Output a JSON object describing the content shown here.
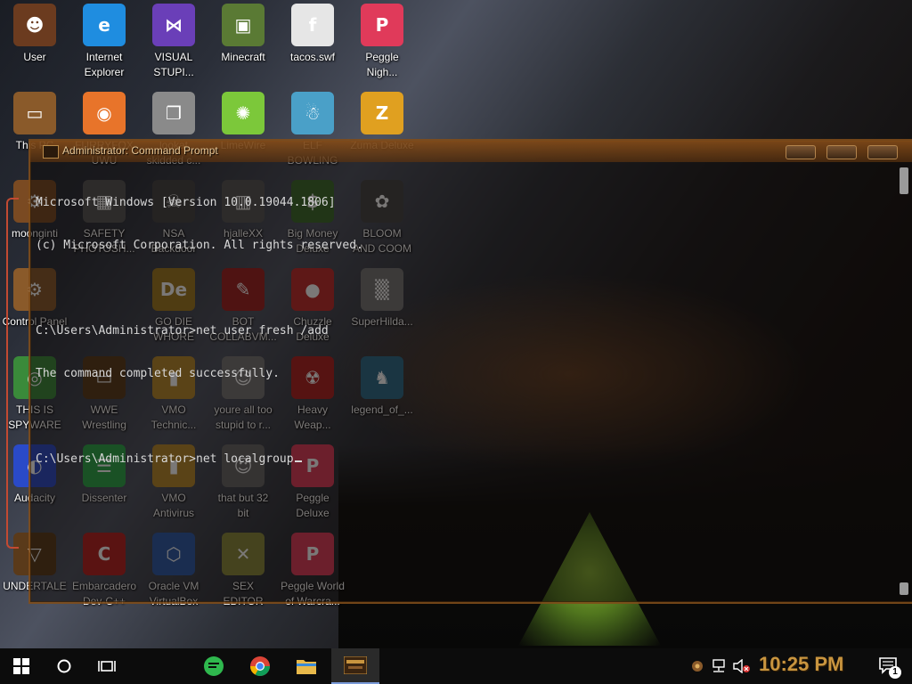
{
  "desktop": {
    "icons": [
      {
        "label": "User",
        "color": "#6b3b1f",
        "glyph": "☻"
      },
      {
        "label": "Internet\nExplorer",
        "color": "#1f8de0",
        "glyph": "e"
      },
      {
        "label": "VISUAL\nSTUPI...",
        "color": "#6a3fb8",
        "glyph": "⋈"
      },
      {
        "label": "Minecraft",
        "color": "#5a7a34",
        "glyph": "▣"
      },
      {
        "label": "tacos.swf",
        "color": "#e6e6e6",
        "glyph": "f"
      },
      {
        "label": "Peggle\nNigh...",
        "color": "#e03a5a",
        "glyph": "P"
      },
      {
        "label": "This PC",
        "color": "#8a5a2a",
        "glyph": "▭"
      },
      {
        "label": "FURRYFOX\nUWU",
        "color": "#e8742a",
        "glyph": "◉"
      },
      {
        "label": "lookat\nskidded c...",
        "color": "#8a8a8a",
        "glyph": "❐"
      },
      {
        "label": "LimeWire",
        "color": "#7cc83a",
        "glyph": "✺"
      },
      {
        "label": "ELF\nBOWLING",
        "color": "#4aa0c8",
        "glyph": "☃"
      },
      {
        "label": "Zuma Deluxe",
        "color": "#e0a020",
        "glyph": "Z"
      },
      {
        "label": "moonginti",
        "color": "#7a4a22",
        "glyph": "⚙"
      },
      {
        "label": "SAFETY\nPHOTOSH...",
        "color": "#555555",
        "glyph": "▦"
      },
      {
        "label": "NSA\nBackdoor",
        "color": "#444444",
        "glyph": "☠"
      },
      {
        "label": "hjalleXX",
        "color": "#555555",
        "glyph": "▥"
      },
      {
        "label": "Big Money\nDeluxe",
        "color": "#3a6a2a",
        "glyph": "$"
      },
      {
        "label": "BLOOM\nAND COOM",
        "color": "#444444",
        "glyph": "✿"
      },
      {
        "label": "Control Panel",
        "color": "#8a5a2a",
        "glyph": "⚙"
      },
      {
        "label": "GO DIE\nWHORE",
        "color": "#a07a20",
        "glyph": "De"
      },
      {
        "label": "BOT\nCOLLABVM...",
        "color": "#a02020",
        "glyph": "✎"
      },
      {
        "label": "Chuzzle\nDeluxe",
        "color": "#c02a2a",
        "glyph": "●"
      },
      {
        "label": "SuperHilda...",
        "color": "#777777",
        "glyph": "▒"
      },
      {
        "label": "THIS IS\nSPYWARE",
        "color": "#3a8a3a",
        "glyph": "◎"
      },
      {
        "label": "WWE\nWrestling",
        "color": "#5a3a1a",
        "glyph": "▭"
      },
      {
        "label": "VMO\nTechnic...",
        "color": "#b8892a",
        "glyph": "▮"
      },
      {
        "label": "youre all too\nstupid to r...",
        "color": "#777777",
        "glyph": "☺"
      },
      {
        "label": "Heavy\nWeap...",
        "color": "#b02020",
        "glyph": "☢"
      },
      {
        "label": "legend_of_...",
        "color": "#2a6a8a",
        "glyph": "♞"
      },
      {
        "label": "Audacity",
        "color": "#2a4ac8",
        "glyph": "◐"
      },
      {
        "label": "Dissenter",
        "color": "#2aa84a",
        "glyph": "☰"
      },
      {
        "label": "VMO\nAntivirus",
        "color": "#b8892a",
        "glyph": "▮"
      },
      {
        "label": "that but 32\nbit",
        "color": "#666666",
        "glyph": "☺"
      },
      {
        "label": "Peggle\nDeluxe",
        "color": "#e03a5a",
        "glyph": "P"
      },
      {
        "label": "UNDERTALE",
        "color": "#5a3a1a",
        "glyph": "▽"
      },
      {
        "label": "Embarcadero\nDev-C++",
        "color": "#b82020",
        "glyph": "C"
      },
      {
        "label": "Oracle VM\nVirtualBox",
        "color": "#2a5aa8",
        "glyph": "⬡"
      },
      {
        "label": "SEX\nEDITOR",
        "color": "#8a8a3a",
        "glyph": "✕"
      },
      {
        "label": "Peggle World\nof Warcra...",
        "color": "#e03a5a",
        "glyph": "P"
      }
    ]
  },
  "console": {
    "title": "Administrator: Command Prompt",
    "lines": [
      "Microsoft Windows [Version 10.0.19044.1806]",
      "(c) Microsoft Corporation. All rights reserved.",
      "",
      "C:\\Users\\Administrator>net user fresh /add",
      "The command completed successfully.",
      "",
      "C:\\Users\\Administrator>net localgroup"
    ]
  },
  "taskbar": {
    "time": "10:25 PM",
    "notification_count": "1"
  }
}
